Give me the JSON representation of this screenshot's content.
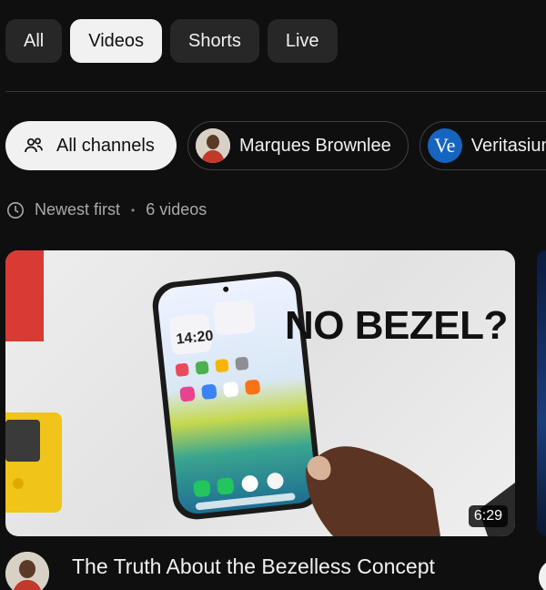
{
  "tabs": [
    {
      "label": "All",
      "active": false
    },
    {
      "label": "Videos",
      "active": true
    },
    {
      "label": "Shorts",
      "active": false
    },
    {
      "label": "Live",
      "active": false
    }
  ],
  "channels": {
    "all_label": "All channels",
    "items": [
      {
        "name": "Marques Brownlee",
        "avatar": "mkbhd"
      },
      {
        "name": "Veritasium",
        "avatar_text": "Ve"
      }
    ]
  },
  "sort": {
    "label": "Newest first",
    "count": "6 videos"
  },
  "video": {
    "thumbnail_text": "NO BEZEL?",
    "phone_time": "14:20",
    "duration": "6:29",
    "title": "The Truth About the Bezelless Concept"
  },
  "colors": {
    "background": "#0f0f0f",
    "chip": "#272727",
    "chip_active": "#f1f1f1",
    "secondary_text": "#aaaaaa"
  }
}
